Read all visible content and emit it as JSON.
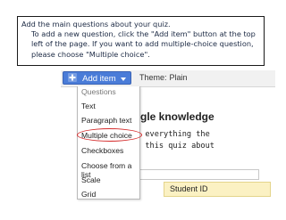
{
  "instructions": {
    "heading": "Add the main questions about your quiz.",
    "body": "To add a new question, click the \"Add item\" button at the top left of the page. If you want to add multiple-choice question, please choose \"Multiple choice\"."
  },
  "toolbar": {
    "add_item_label": "Add item",
    "theme_label": "Theme:",
    "theme_value": "Plain"
  },
  "menu": {
    "heading": "Questions",
    "items": [
      "Text",
      "Paragraph text",
      "Multiple choice",
      "Checkboxes",
      "Choose from a list",
      "Scale",
      "Grid"
    ]
  },
  "form": {
    "title_fragment": "gle knowledge",
    "description_lines": [
      "y everything the",
      "e this quiz about"
    ],
    "field_label": "Student ID"
  },
  "colors": {
    "accent": "#4a7cd8",
    "highlight_circle": "#d42a2a",
    "field_background": "#fbf1c3"
  }
}
